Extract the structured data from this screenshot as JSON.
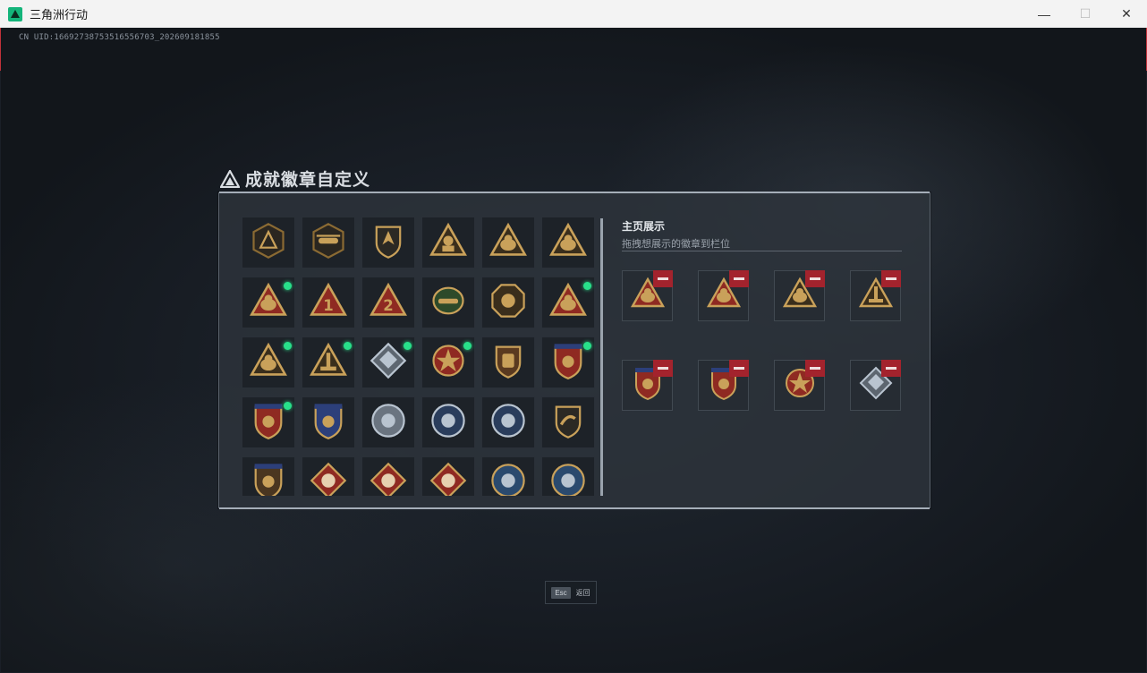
{
  "window": {
    "title": "三角洲行动",
    "minimize": "—",
    "maximize": "☐",
    "close": "✕"
  },
  "uid": "CN UID:16692738753516556703_202609181855",
  "panel": {
    "title": "成就徽章自定义"
  },
  "showcase": {
    "title": "主页展示",
    "subtitle": "拖拽想展示的徽章到栏位"
  },
  "esc": {
    "key": "Esc",
    "label": "返回"
  },
  "colors": {
    "gold": "#c9a15a",
    "dark_gold": "#8a6a33",
    "red_badge": "#8f2a22",
    "navy": "#2c3f7a",
    "silver": "#b9c4d0",
    "new_dot": "#28e08a",
    "remove": "#a3232d"
  },
  "badges": [
    {
      "kind": "hex-dark",
      "new": false
    },
    {
      "kind": "hex-heli",
      "new": false
    },
    {
      "kind": "shield-arrow",
      "new": false
    },
    {
      "kind": "tri-56",
      "new": false
    },
    {
      "kind": "tri-gold",
      "new": false
    },
    {
      "kind": "tri-beast",
      "new": false
    },
    {
      "kind": "tri-red",
      "new": true
    },
    {
      "kind": "tri-1",
      "new": false
    },
    {
      "kind": "tri-2",
      "new": false
    },
    {
      "kind": "green-heli",
      "new": false
    },
    {
      "kind": "oct-gold",
      "new": false
    },
    {
      "kind": "tri-red2",
      "new": true
    },
    {
      "kind": "tri-gold2",
      "new": true
    },
    {
      "kind": "tri-tower",
      "new": true
    },
    {
      "kind": "diamond-silver",
      "new": true
    },
    {
      "kind": "star-red",
      "new": true
    },
    {
      "kind": "shield-gold",
      "new": false
    },
    {
      "kind": "crest-red",
      "new": true
    },
    {
      "kind": "crest-red2",
      "new": true
    },
    {
      "kind": "crest-navy",
      "new": false
    },
    {
      "kind": "round-silver",
      "new": false
    },
    {
      "kind": "round-navy",
      "new": false
    },
    {
      "kind": "round-navy2",
      "new": false
    },
    {
      "kind": "shield-dark",
      "new": false
    },
    {
      "kind": "crest-gold",
      "new": false
    },
    {
      "kind": "diamond-red",
      "new": false
    },
    {
      "kind": "diamond-red2",
      "new": false
    },
    {
      "kind": "diamond-red3",
      "new": false
    },
    {
      "kind": "round-blue",
      "new": false
    },
    {
      "kind": "round-blue2",
      "new": false
    }
  ],
  "slots": [
    {
      "kind": "tri-red"
    },
    {
      "kind": "tri-red2"
    },
    {
      "kind": "tri-gold2"
    },
    {
      "kind": "tri-tower"
    },
    {
      "kind": "crest-red"
    },
    {
      "kind": "crest-red2"
    },
    {
      "kind": "star-red"
    },
    {
      "kind": "diamond-silver"
    }
  ]
}
